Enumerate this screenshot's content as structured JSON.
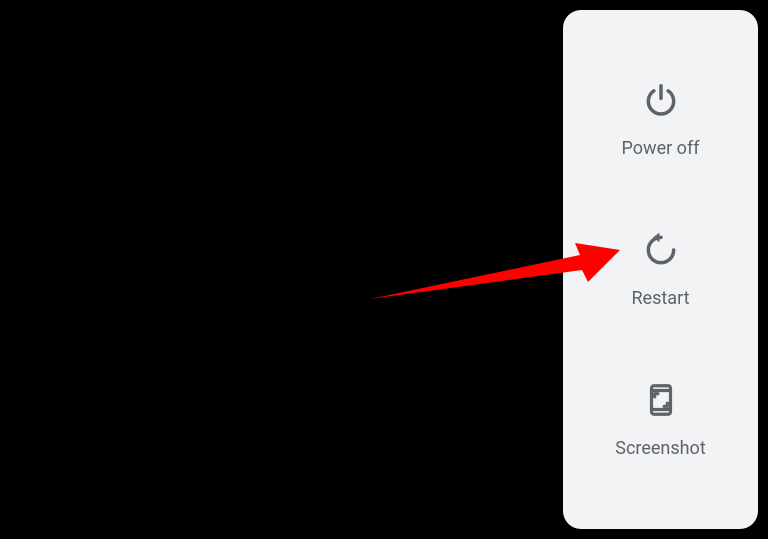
{
  "menu": {
    "items": [
      {
        "label": "Power off"
      },
      {
        "label": "Restart"
      },
      {
        "label": "Screenshot"
      }
    ]
  }
}
